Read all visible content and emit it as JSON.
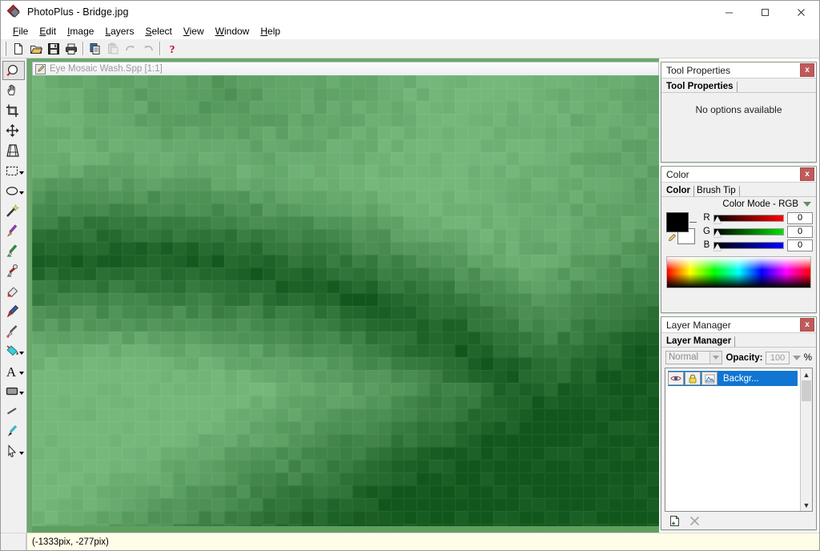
{
  "window": {
    "app_title": "PhotoPlus - Bridge.jpg",
    "app_icon": "photoplus-diamond-icon",
    "minimize_label": "–",
    "maximize_label": "□",
    "close_label": "✕"
  },
  "menubar": {
    "items": [
      {
        "label": "File",
        "mnemonic": "F"
      },
      {
        "label": "Edit",
        "mnemonic": "E"
      },
      {
        "label": "Image",
        "mnemonic": "I"
      },
      {
        "label": "Layers",
        "mnemonic": "L"
      },
      {
        "label": "Select",
        "mnemonic": "S"
      },
      {
        "label": "View",
        "mnemonic": "V"
      },
      {
        "label": "Window",
        "mnemonic": "W"
      },
      {
        "label": "Help",
        "mnemonic": "H"
      }
    ]
  },
  "toolbar": {
    "buttons": [
      {
        "name": "new-document-button",
        "icon": "page-icon",
        "enabled": true
      },
      {
        "name": "open-button",
        "icon": "folder-open-icon",
        "enabled": true
      },
      {
        "name": "save-button",
        "icon": "floppy-disk-icon",
        "enabled": true
      },
      {
        "name": "print-button",
        "icon": "printer-icon",
        "enabled": true
      },
      {
        "name": "copy-button",
        "icon": "copy-icon",
        "enabled": true
      },
      {
        "name": "paste-button",
        "icon": "paste-icon",
        "enabled": false
      },
      {
        "name": "undo-button",
        "icon": "undo-arrow-icon",
        "enabled": false
      },
      {
        "name": "redo-button",
        "icon": "redo-arrow-icon",
        "enabled": false
      },
      {
        "name": "help-button",
        "icon": "question-mark-icon",
        "enabled": true
      }
    ]
  },
  "tool_palette": {
    "tools": [
      {
        "name": "zoom-tool",
        "icon": "magnifier-icon",
        "selected": true,
        "has_flyout": false
      },
      {
        "name": "pan-tool",
        "icon": "hand-icon",
        "selected": false,
        "has_flyout": false
      },
      {
        "name": "crop-tool",
        "icon": "crop-icon",
        "selected": false,
        "has_flyout": false
      },
      {
        "name": "move-tool",
        "icon": "four-arrows-icon",
        "selected": false,
        "has_flyout": false
      },
      {
        "name": "perspective-tool",
        "icon": "mesh-warp-icon",
        "selected": false,
        "has_flyout": false
      },
      {
        "name": "rectangle-select-tool",
        "icon": "dashed-rectangle-icon",
        "selected": false,
        "has_flyout": true
      },
      {
        "name": "ellipse-select-tool",
        "icon": "ellipse-icon",
        "selected": false,
        "has_flyout": true
      },
      {
        "name": "magic-wand-tool",
        "icon": "magic-wand-icon",
        "selected": false,
        "has_flyout": false
      },
      {
        "name": "paintbrush-tool",
        "icon": "paintbrush-icon",
        "selected": false,
        "has_flyout": false
      },
      {
        "name": "pencil-tool",
        "icon": "pencil-icon",
        "selected": false,
        "has_flyout": false
      },
      {
        "name": "clone-tool",
        "icon": "clone-stamp-icon",
        "selected": false,
        "has_flyout": false
      },
      {
        "name": "eraser-tool",
        "icon": "eraser-icon",
        "selected": false,
        "has_flyout": false
      },
      {
        "name": "smudge-tool",
        "icon": "smudge-icon",
        "selected": false,
        "has_flyout": false
      },
      {
        "name": "retouch-tool",
        "icon": "retouch-brush-icon",
        "selected": false,
        "has_flyout": false
      },
      {
        "name": "fill-tool",
        "icon": "paint-bucket-icon",
        "selected": false,
        "has_flyout": true
      },
      {
        "name": "text-tool",
        "icon": "letter-a-icon",
        "selected": false,
        "has_flyout": true
      },
      {
        "name": "shape-tool",
        "icon": "rounded-rectangle-icon",
        "selected": false,
        "has_flyout": true
      },
      {
        "name": "line-tool",
        "icon": "line-icon",
        "selected": false,
        "has_flyout": false
      },
      {
        "name": "pen-tool",
        "icon": "pen-icon",
        "selected": false,
        "has_flyout": false
      },
      {
        "name": "node-edit-tool",
        "icon": "arrow-cursor-icon",
        "selected": false,
        "has_flyout": true
      }
    ]
  },
  "document": {
    "title": "Eye Mosaic Wash.Spp [1:1]",
    "icon": "document-edit-icon",
    "zoom_ratio": "1:1",
    "active": false
  },
  "panels": {
    "tool_properties": {
      "title": "Tool Properties",
      "tab_label": "Tool Properties",
      "empty_message": "No options available",
      "close_label": "x"
    },
    "color": {
      "title": "Color",
      "tabs": [
        {
          "label": "Color",
          "active": true
        },
        {
          "label": "Brush Tip",
          "active": false
        }
      ],
      "color_mode_label": "Color Mode - RGB",
      "close_label": "x",
      "foreground_color": "#000000",
      "background_color": "#ffffff",
      "channels": [
        {
          "label": "R",
          "value": "0"
        },
        {
          "label": "G",
          "value": "0"
        },
        {
          "label": "B",
          "value": "0"
        }
      ]
    },
    "layer_manager": {
      "title": "Layer Manager",
      "tab_label": "Layer Manager",
      "close_label": "x",
      "blend_mode": "Normal",
      "opacity_label": "Opacity:",
      "opacity_value": "100",
      "opacity_unit": "%",
      "layers": [
        {
          "name": "Backgr...",
          "selected": true,
          "visible_icon": "eye-icon",
          "lock_icon": "padlock-icon",
          "mask_icon": "layer-mask-icon"
        }
      ],
      "footer_buttons": [
        {
          "name": "new-layer-button",
          "icon": "new-page-icon",
          "enabled": true
        },
        {
          "name": "delete-layer-button",
          "icon": "x-cross-icon",
          "enabled": false
        }
      ]
    }
  },
  "statusbar": {
    "coordinates": "(-1333pix, -277pix)"
  },
  "canvas": {
    "mosaic": {
      "tile_size": 16,
      "base_color": "#6ab46f",
      "dark_color": "#15601f",
      "description": "pixelated mosaic of green leaf image"
    }
  }
}
